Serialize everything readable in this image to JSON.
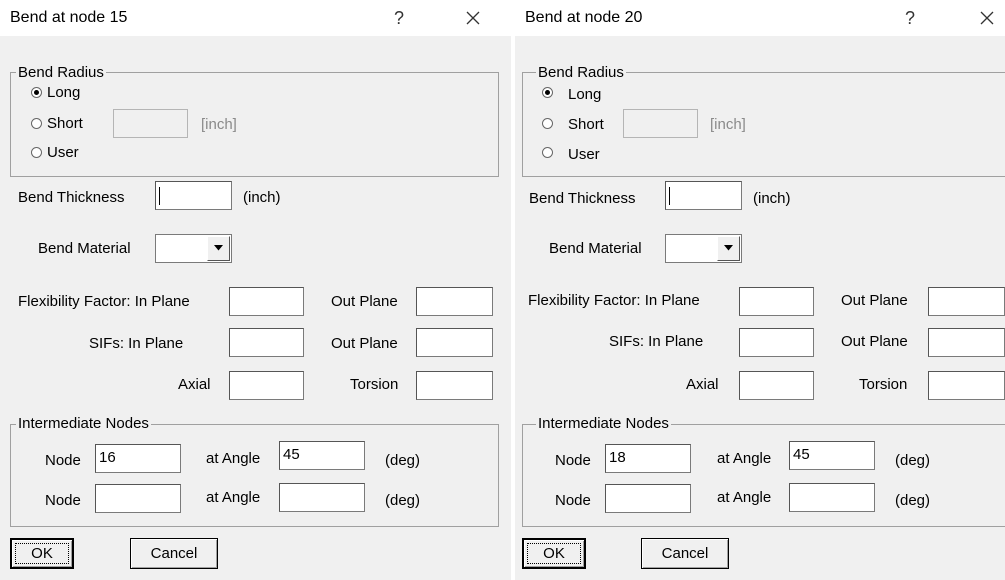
{
  "dialogs": [
    {
      "title": "Bend at node 15",
      "help_glyph": "?",
      "bend_radius": {
        "group_label": "Bend Radius",
        "options": {
          "long": "Long",
          "short": "Short",
          "user": "User"
        },
        "selected": "long",
        "short_unit": "[inch]",
        "short_value": ""
      },
      "bend_thickness": {
        "label": "Bend Thickness",
        "value": "",
        "unit": "(inch)"
      },
      "bend_material": {
        "label": "Bend Material",
        "value": ""
      },
      "flexibility": {
        "label": "Flexibility Factor: In Plane",
        "out_label": "Out Plane",
        "in_value": "",
        "out_value": ""
      },
      "sifs": {
        "label": "SIFs:  In Plane",
        "out_label": "Out Plane",
        "in_value": "",
        "out_value": ""
      },
      "axial": {
        "label": "Axial",
        "value": ""
      },
      "torsion": {
        "label": "Torsion",
        "value": ""
      },
      "intermediate": {
        "group_label": "Intermediate Nodes",
        "rows": [
          {
            "node_label": "Node",
            "node_value": "16",
            "angle_label": "at Angle",
            "angle_value": "45",
            "unit": "(deg)"
          },
          {
            "node_label": "Node",
            "node_value": "",
            "angle_label": "at Angle",
            "angle_value": "",
            "unit": "(deg)"
          }
        ]
      },
      "ok_label": "OK",
      "cancel_label": "Cancel"
    },
    {
      "title": "Bend at node 20",
      "help_glyph": "?",
      "bend_radius": {
        "group_label": "Bend Radius",
        "options": {
          "long": "Long",
          "short": "Short",
          "user": "User"
        },
        "selected": "long",
        "short_unit": "[inch]",
        "short_value": ""
      },
      "bend_thickness": {
        "label": "Bend Thickness",
        "value": "",
        "unit": "(inch)"
      },
      "bend_material": {
        "label": "Bend Material",
        "value": ""
      },
      "flexibility": {
        "label": "Flexibility Factor: In Plane",
        "out_label": "Out Plane",
        "in_value": "",
        "out_value": ""
      },
      "sifs": {
        "label": "SIFs:  In Plane",
        "out_label": "Out Plane",
        "in_value": "",
        "out_value": ""
      },
      "axial": {
        "label": "Axial",
        "value": ""
      },
      "torsion": {
        "label": "Torsion",
        "value": ""
      },
      "intermediate": {
        "group_label": "Intermediate Nodes",
        "rows": [
          {
            "node_label": "Node",
            "node_value": "18",
            "angle_label": "at Angle",
            "angle_value": "45",
            "unit": "(deg)"
          },
          {
            "node_label": "Node",
            "node_value": "",
            "angle_label": "at Angle",
            "angle_value": "",
            "unit": "(deg)"
          }
        ]
      },
      "ok_label": "OK",
      "cancel_label": "Cancel"
    }
  ]
}
